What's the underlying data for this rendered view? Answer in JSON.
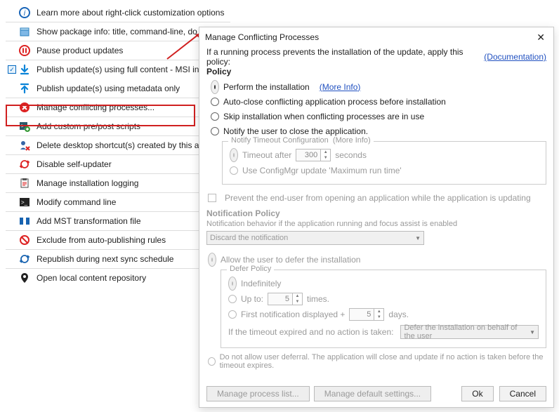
{
  "menu": [
    {
      "label": "Learn more about right-click customization options"
    },
    {
      "label": "Show package info: title, command-line, do"
    },
    {
      "label": "Pause product updates"
    },
    {
      "label": "Publish update(s) using full content - MSI in"
    },
    {
      "label": "Publish update(s) using metadata only"
    },
    {
      "label": "Manage conflicting processes..."
    },
    {
      "label": "Add custom pre/post scripts"
    },
    {
      "label": "Delete desktop shortcut(s) created by this ap"
    },
    {
      "label": "Disable self-updater"
    },
    {
      "label": "Manage installation logging"
    },
    {
      "label": "Modify command line"
    },
    {
      "label": "Add MST transformation file"
    },
    {
      "label": "Exclude from auto-publishing rules"
    },
    {
      "label": "Republish during next sync schedule"
    },
    {
      "label": "Open local content repository"
    }
  ],
  "dialog": {
    "title": "Manage Conflicting Processes",
    "intro": "If a running process prevents the installation of the update, apply this policy:",
    "doc_link": "(Documentation)",
    "policy_header": "Policy",
    "opt1": "Perform the installation",
    "more_info": "(More Info)",
    "opt2": "Auto-close conflicting application process before installation",
    "opt3": "Skip installation when conflicting processes are in use",
    "opt4": "Notify the user to close the application.",
    "nt_legend_a": "Notify Timeout Configuration",
    "nt_legend_b": "(More Info)",
    "nt_timeout_a": "Timeout after",
    "nt_timeout_val": "300",
    "nt_timeout_b": "seconds",
    "nt_cfg": "Use ConfigMgr update 'Maximum run time'",
    "prevent": "Prevent the end-user from opening an application while the application is updating",
    "np_header": "Notification Policy",
    "np_sub": "Notification behavior if the application running and focus assist is enabled",
    "np_select": "Discard the notification",
    "allow_defer": "Allow the user to defer the installation",
    "dp_legend": "Defer Policy",
    "dp_ind": "Indefinitely",
    "dp_upto_a": "Up to:",
    "dp_upto_v": "5",
    "dp_upto_b": "times.",
    "dp_first_a": "First notification displayed +",
    "dp_first_v": "5",
    "dp_first_b": "days.",
    "dp_exp": "If the timeout expired and no action is taken:",
    "dp_exp_sel": "Defer the installation on behalf of the user",
    "no_defer": "Do not allow user deferral. The application will close and update if no action is taken before the timeout expires.",
    "btn_mpl": "Manage process list...",
    "btn_mds": "Manage default settings...",
    "btn_ok": "Ok",
    "btn_cancel": "Cancel"
  }
}
